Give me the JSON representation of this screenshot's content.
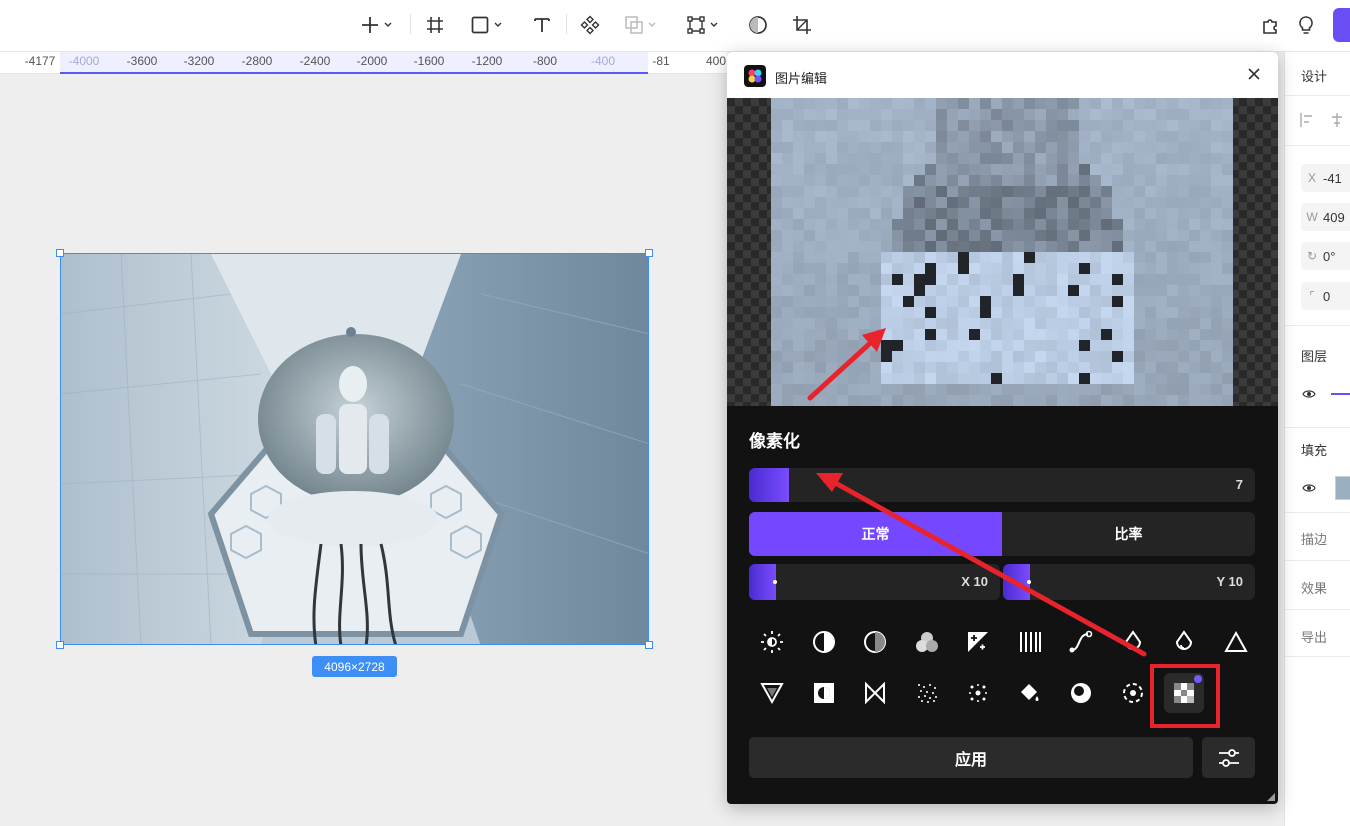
{
  "toolbar": {
    "tools": [
      {
        "icon": "plus-icon",
        "has_menu": true
      },
      {
        "icon": "frame-icon",
        "has_menu": false
      },
      {
        "icon": "rectangle-icon",
        "has_menu": true
      },
      {
        "icon": "text-icon",
        "has_menu": false
      },
      {
        "icon": "component-icon",
        "has_menu": false
      },
      {
        "icon": "boolean-icon",
        "has_menu": true
      },
      {
        "icon": "vector-path-icon",
        "has_menu": true
      },
      {
        "icon": "ellipse-mask-icon",
        "has_menu": false
      },
      {
        "icon": "crop-icon",
        "has_menu": false
      }
    ],
    "right_icons": [
      "plugin-icon",
      "bulb-icon"
    ],
    "accent_color": "#6b4df5"
  },
  "ruler": {
    "ticks": [
      "-4177",
      "-4000",
      "-3600",
      "-3200",
      "-2800",
      "-2400",
      "-2000",
      "-1600",
      "-1200",
      "-800",
      "-400",
      "-81",
      "400"
    ],
    "selection_color": "#5b57f0"
  },
  "canvas": {
    "image_size_label": "4096×2728",
    "selection_color": "#3c8ff0"
  },
  "dialog": {
    "title": "图片编辑",
    "section_title": "像素化",
    "intensity": {
      "value": "7",
      "fill_fraction": 0.08
    },
    "mode_options": [
      {
        "label": "正常",
        "active": true
      },
      {
        "label": "比率",
        "active": false
      }
    ],
    "x_field": {
      "label": "X 10"
    },
    "y_field": {
      "label": "Y 10"
    },
    "effects_row1": [
      "brightness-icon",
      "contrast-icon",
      "half-contrast-icon",
      "color-balance-icon",
      "exposure-icon",
      "stripes-icon",
      "curves-icon",
      "droplet-icon",
      "sharpen-drop-icon",
      "triangle-icon"
    ],
    "effects_row2": [
      "triangle-down-icon",
      "invert-icon",
      "bowtie-icon",
      "noise-icon",
      "sparkle-icon",
      "fill-bucket-icon",
      "vignette-icon",
      "rotate-dashed-icon",
      "pixelate-icon"
    ],
    "selected_effect": "pixelate-icon",
    "apply_label": "应用",
    "accent_color": "#7548ff"
  },
  "right_panel": {
    "tab_label": "设计",
    "x_label": "X",
    "x_value": "-41",
    "w_label": "W",
    "w_value": "409",
    "rotation_value": "0°",
    "radius_value": "0",
    "layers_label": "图层",
    "fill_label": "填充",
    "stroke_label": "描边",
    "effects_label": "效果",
    "export_label": "导出"
  },
  "annotations": {
    "highlight_color": "#e8232b"
  }
}
